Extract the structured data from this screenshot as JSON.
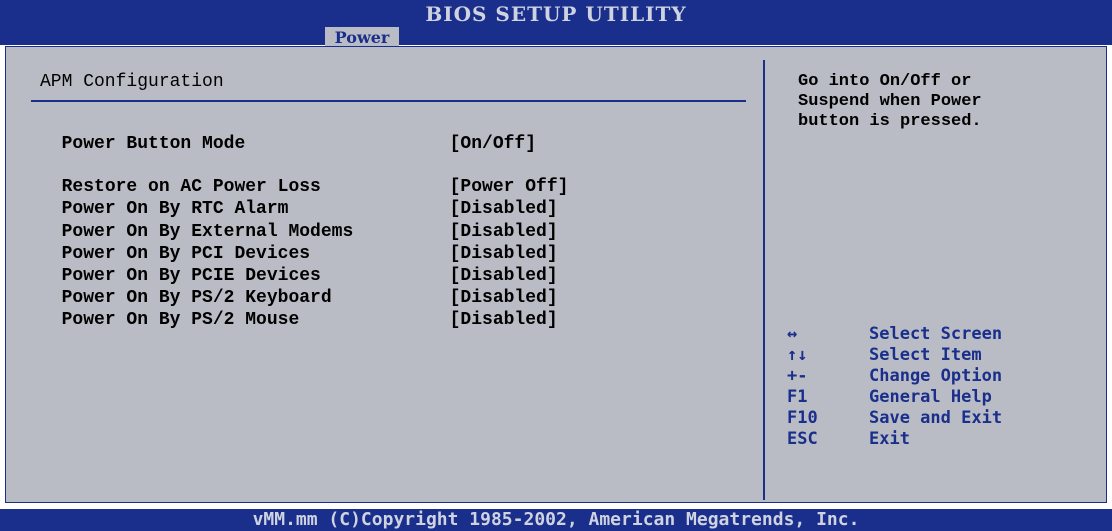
{
  "header": {
    "title": "BIOS SETUP UTILITY",
    "active_tab": "Power"
  },
  "main": {
    "section_title": "APM Configuration",
    "settings": [
      {
        "label": "Power Button Mode",
        "value": "[On/Off]"
      },
      {
        "label": "Restore on AC Power Loss",
        "value": "[Power Off]"
      },
      {
        "label": "Power On By RTC Alarm",
        "value": "[Disabled]"
      },
      {
        "label": "Power On By External Modems",
        "value": "[Disabled]"
      },
      {
        "label": "Power On By PCI Devices",
        "value": "[Disabled]"
      },
      {
        "label": "Power On By PCIE Devices",
        "value": "[Disabled]"
      },
      {
        "label": "Power On By PS/2 Keyboard",
        "value": "[Disabled]"
      },
      {
        "label": "Power On By PS/2 Mouse",
        "value": "[Disabled]"
      }
    ]
  },
  "help": {
    "text": "Go into On/Off or\nSuspend when Power\nbutton is pressed.",
    "keys": [
      {
        "key": "↔",
        "desc": "Select Screen"
      },
      {
        "key": "↑↓",
        "desc": "Select Item"
      },
      {
        "key": "+-",
        "desc": "Change Option"
      },
      {
        "key": "F1",
        "desc": "General Help"
      },
      {
        "key": "F10",
        "desc": "Save and Exit"
      },
      {
        "key": "ESC",
        "desc": "Exit"
      }
    ]
  },
  "footer": {
    "copyright": "vMM.mm (C)Copyright 1985-2002, American Megatrends, Inc."
  },
  "colors": {
    "bar": "#1a2e8c",
    "panel": "#b9bcc4",
    "accent_text": "#1a2e8c"
  }
}
